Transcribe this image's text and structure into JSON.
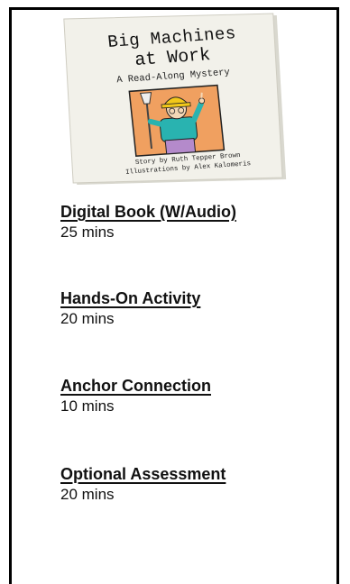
{
  "book": {
    "title_line1": "Big Machines",
    "title_line2": "at Work",
    "subtitle": "A Read-Along Mystery",
    "credit_line1": "Story by Ruth Tepper Brown",
    "credit_line2": "Illustrations by Alex Kalomeris"
  },
  "items": [
    {
      "title": "Digital Book (W/Audio)",
      "time": "25 mins"
    },
    {
      "title": "Hands-On Activity",
      "time": "20 mins"
    },
    {
      "title": "Anchor Connection",
      "time": "10 mins"
    },
    {
      "title": "Optional Assessment",
      "time": "20 mins"
    }
  ],
  "colors": {
    "border": "#000000",
    "cover_bg": "#f2f1ea",
    "illustration_bg": "#f0a060",
    "helmet": "#f2c81a",
    "shirt": "#29b3b0"
  }
}
